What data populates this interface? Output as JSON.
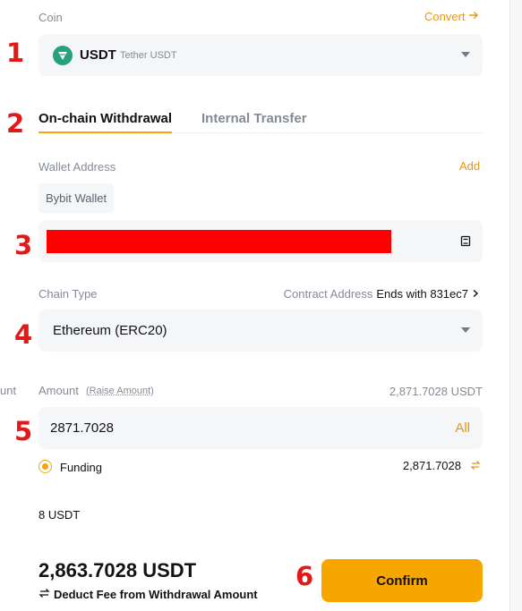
{
  "coin": {
    "label": "Coin",
    "convert_label": "Convert",
    "symbol": "USDT",
    "name": "Tether USDT",
    "icon": "tether-icon",
    "icon_color": "#26a17b"
  },
  "tabs": [
    {
      "label": "On-chain Withdrawal",
      "active": true
    },
    {
      "label": "Internal Transfer",
      "active": false
    }
  ],
  "wallet": {
    "label": "Wallet Address",
    "add_label": "Add",
    "chip_label": "Bybit Wallet",
    "address_value": ""
  },
  "chain": {
    "label": "Chain Type",
    "contract_label": "Contract Address",
    "contract_value": "Ends with 831ec7",
    "selected": "Ethereum (ERC20)"
  },
  "amount": {
    "side_cut_label": "unt",
    "label": "Amount",
    "raise_label": "(Raise Amount)",
    "available": "2,871.7028 USDT",
    "value": "2871.7028",
    "all_label": "All",
    "account_label": "Funding",
    "account_balance": "2,871.7028"
  },
  "fee": "8 USDT",
  "summary": {
    "receive_total": "2,863.7028 USDT",
    "deduct_label": "Deduct Fee from Withdrawal Amount"
  },
  "confirm_label": "Confirm",
  "markers": [
    "1",
    "2",
    "3",
    "4",
    "5",
    "6"
  ],
  "colors": {
    "accent": "#f7a600",
    "accent_text": "#e5951a",
    "field_bg": "#f5f6f8",
    "redaction": "#ff0000",
    "marker": "#e11919"
  }
}
